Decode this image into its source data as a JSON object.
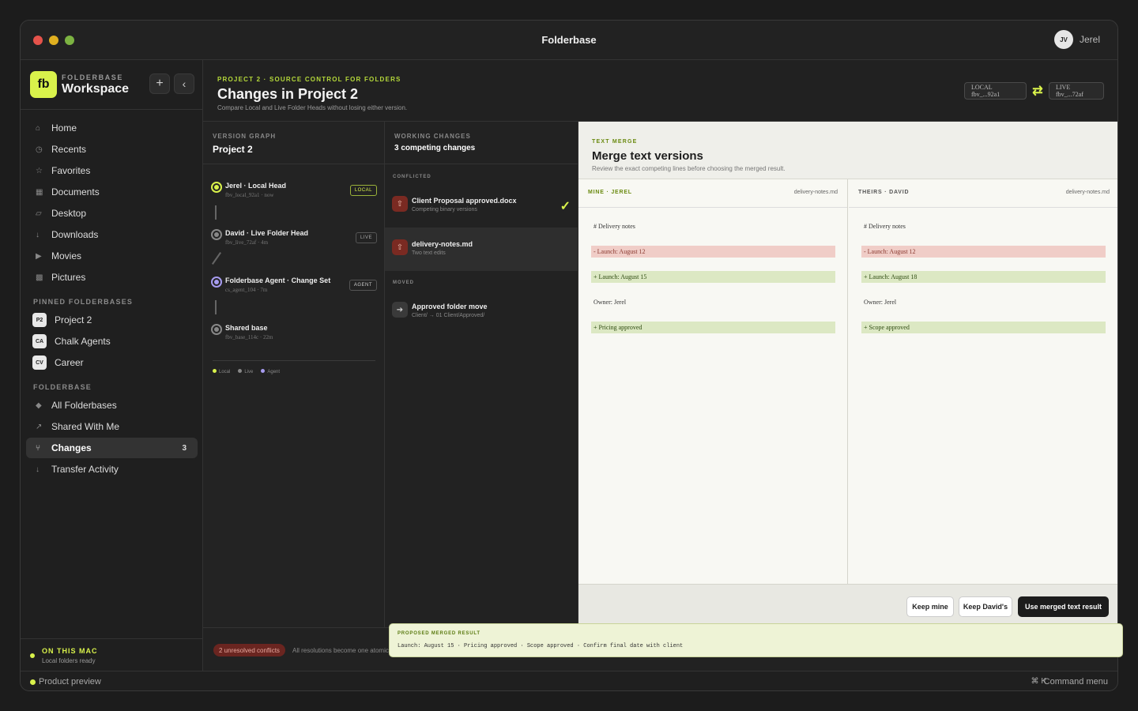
{
  "window": {
    "title": "Folderbase",
    "user_initials": "JV",
    "user_name": "Jerel"
  },
  "sidebar": {
    "brand_kicker": "FOLDERBASE",
    "brand_name": "Workspace",
    "logo_text": "fb",
    "add_label": "+",
    "collapse_label": "‹",
    "nav": [
      {
        "label": "Home",
        "icon": "⌂"
      },
      {
        "label": "Recents",
        "icon": "◷"
      },
      {
        "label": "Favorites",
        "icon": "☆"
      },
      {
        "label": "Documents",
        "icon": "▦"
      },
      {
        "label": "Desktop",
        "icon": "▱"
      },
      {
        "label": "Downloads",
        "icon": "↓"
      },
      {
        "label": "Movies",
        "icon": "▶"
      },
      {
        "label": "Pictures",
        "icon": "▩"
      }
    ],
    "pinned_title": "PINNED FOLDERBASES",
    "pinned": [
      {
        "badge": "P2",
        "label": "Project 2"
      },
      {
        "badge": "CA",
        "label": "Chalk Agents"
      },
      {
        "badge": "CV",
        "label": "Career"
      }
    ],
    "folderbase_title": "FOLDERBASE",
    "folderbase": [
      {
        "label": "All Folderbases",
        "icon": "◆"
      },
      {
        "label": "Shared With Me",
        "icon": "↗"
      },
      {
        "label": "Changes",
        "icon": "⑂",
        "count": "3"
      },
      {
        "label": "Transfer Activity",
        "icon": "↓"
      }
    ],
    "footer_title": "ON THIS MAC",
    "footer_sub": "Local folders ready"
  },
  "statusbar": {
    "left": "Product preview",
    "shortcut": "⌘ K",
    "right": "Command menu"
  },
  "header": {
    "kicker": "PROJECT 2 · SOURCE CONTROL FOR FOLDERS",
    "title": "Changes in Project 2",
    "subtitle": "Compare Local and Live Folder Heads without losing either version.",
    "local_hash": "LOCAL fbv_...92a1",
    "swap_icon": "⇄",
    "live_hash": "LIVE fbv_...72af"
  },
  "graph": {
    "kicker": "VERSION GRAPH",
    "title": "Project 2",
    "nodes": [
      {
        "name": "Jerel · Local Head",
        "meta": "fbv_local_92a1 · now",
        "tag": "LOCAL"
      },
      {
        "name": "David · Live Folder Head",
        "meta": "fbv_live_72af · 4m",
        "tag": "LIVE"
      },
      {
        "name": "Folderbase Agent · Change Set",
        "meta": "cs_agent_104 · 7m",
        "tag": "AGENT"
      },
      {
        "name": "Shared base",
        "meta": "fbv_base_114c · 22m",
        "tag": ""
      }
    ],
    "legend": [
      "Local",
      "Live",
      "Agent"
    ],
    "colors": {
      "local": "#d9f24b",
      "live": "#888888",
      "agent": "#a79cf0"
    }
  },
  "working": {
    "kicker": "WORKING CHANGES",
    "title": "3 competing changes",
    "conflicted_title": "CONFLICTED",
    "conflicted": [
      {
        "name": "Client Proposal approved.docx",
        "sub": "Competing binary versions",
        "icon": "⇧"
      },
      {
        "name": "delivery-notes.md",
        "sub": "Two text edits",
        "icon": "⇧"
      }
    ],
    "check_icon": "✓",
    "moved_title": "MOVED",
    "moved": [
      {
        "name": "Approved folder move",
        "sub": "Client/ → 01 Client/Approved/",
        "icon": "➔"
      }
    ]
  },
  "merge": {
    "kicker": "TEXT MERGE",
    "title": "Merge text versions",
    "subtitle": "Review the exact competing lines before choosing the merged result.",
    "mine": {
      "label": "MINE · JEREL",
      "file": "delivery-notes.md",
      "lines": [
        {
          "type": "ctx",
          "text": "# Delivery notes"
        },
        {
          "type": "del",
          "text": "- Launch: August 12"
        },
        {
          "type": "add",
          "text": "+ Launch: August 15"
        },
        {
          "type": "ctx",
          "text": "Owner: Jerel"
        },
        {
          "type": "add",
          "text": "+ Pricing approved"
        }
      ]
    },
    "theirs": {
      "label": "THEIRS · DAVID",
      "file": "delivery-notes.md",
      "lines": [
        {
          "type": "ctx",
          "text": "# Delivery notes"
        },
        {
          "type": "del",
          "text": "- Launch: August 12"
        },
        {
          "type": "add",
          "text": "+ Launch: August 18"
        },
        {
          "type": "ctx",
          "text": "Owner: Jerel"
        },
        {
          "type": "add",
          "text": "+ Scope approved"
        }
      ]
    },
    "btn_mine": "Keep mine",
    "btn_theirs": "Keep David's",
    "btn_merged": "Use merged text result"
  },
  "bottom": {
    "conflicts": "2 unresolved conflicts",
    "note": "All resolutions become one atomic"
  },
  "popover": {
    "kicker": "PROPOSED MERGED RESULT",
    "text": "Launch: August 15 · Pricing approved · Scope approved · Confirm final date with client"
  }
}
